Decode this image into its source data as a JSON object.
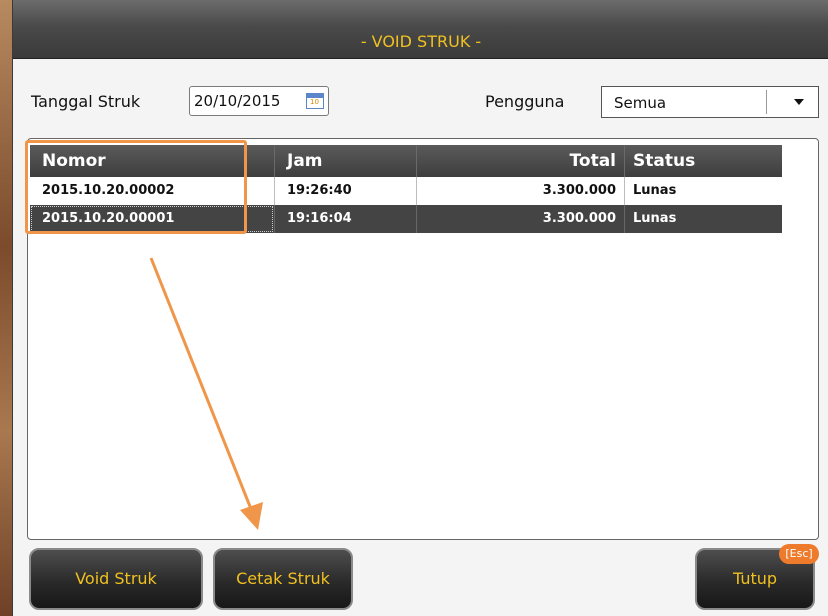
{
  "window": {
    "title": "- VOID STRUK -"
  },
  "filters": {
    "tanggal_label": "Tanggal Struk",
    "tanggal_value": "20/10/2015",
    "calendar_icon_text": "10",
    "pengguna_label": "Pengguna",
    "pengguna_value": "Semua"
  },
  "table": {
    "headers": {
      "nomor": "Nomor",
      "jam": "Jam",
      "total": "Total",
      "status": "Status"
    },
    "rows": [
      {
        "nomor": "2015.10.20.00002",
        "jam": "19:26:40",
        "total": "3.300.000",
        "status": "Lunas"
      },
      {
        "nomor": "2015.10.20.00001",
        "jam": "19:16:04",
        "total": "3.300.000",
        "status": "Lunas"
      }
    ]
  },
  "buttons": {
    "void": "Void Struk",
    "cetak": "Cetak Struk",
    "tutup": "Tutup",
    "tutup_shortcut": "[Esc]"
  },
  "icons": {
    "calendar": "calendar-icon",
    "dropdown": "chevron-down-icon"
  },
  "colors": {
    "title_text": "#f0c020",
    "annotation": "#f0964a",
    "selected_row": "#444444",
    "esc_badge": "#ee7b2c"
  }
}
